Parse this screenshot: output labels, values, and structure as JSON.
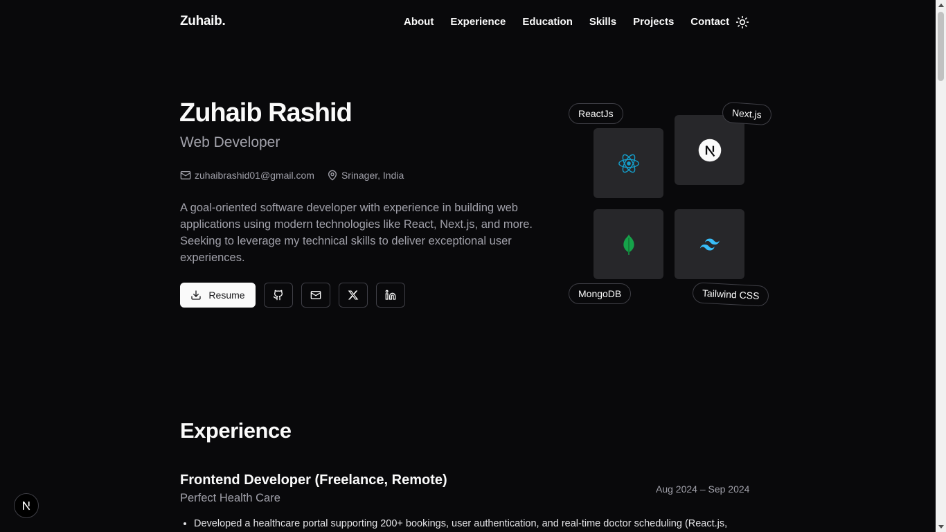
{
  "nav": {
    "logo": "Zuhaib.",
    "links": [
      "About",
      "Experience",
      "Education",
      "Skills",
      "Projects",
      "Contact"
    ],
    "theme_icon": "sun-icon"
  },
  "hero": {
    "name": "Zuhaib Rashid",
    "role": "Web Developer",
    "email": "zuhaibrashid01@gmail.com",
    "location": "Srinager, India",
    "bio": "A goal-oriented software developer with experience in building web applications using modern technologies like React, Next.js, and more. Seeking to leverage my technical skills to deliver exceptional user experiences.",
    "resume_label": "Resume",
    "social_icons": [
      "github-icon",
      "mail-icon",
      "x-icon",
      "linkedin-icon"
    ]
  },
  "tech": {
    "pills": [
      "ReactJs",
      "Next.js",
      "MongoDB",
      "Tailwind CSS"
    ],
    "icons": [
      "react-icon",
      "nextjs-icon",
      "mongodb-icon",
      "tailwind-icon"
    ]
  },
  "experience": {
    "title": "Experience",
    "jobs": [
      {
        "title": "Frontend Developer (Freelance, Remote)",
        "company": "Perfect Health Care",
        "dates": "Aug 2024 – Sep 2024",
        "bullets": [
          "Developed a healthcare portal supporting 200+ bookings, user authentication, and real-time doctor scheduling (React.js,"
        ]
      }
    ]
  },
  "colors": {
    "background": "#09090b",
    "tile": "#27272a",
    "muted_text": "#a1a1aa",
    "react": "#149eca",
    "mongodb": "#16a34a",
    "tailwind": "#38bdf8"
  }
}
